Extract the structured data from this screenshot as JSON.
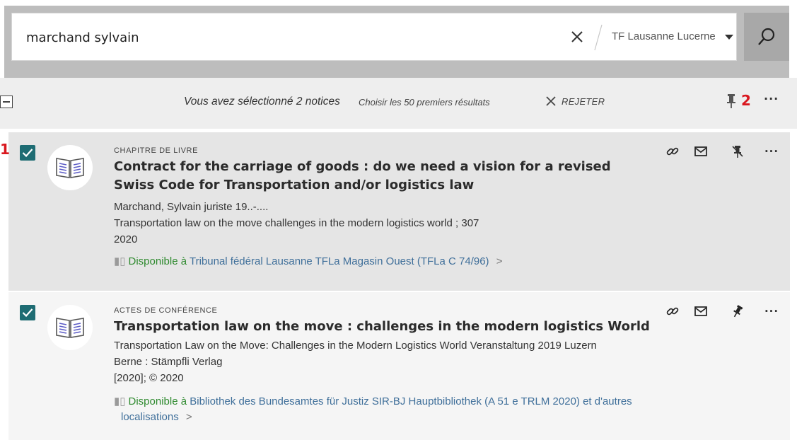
{
  "search": {
    "query": "marchand sylvain",
    "scope": "TF Lausanne Lucerne"
  },
  "toolbar": {
    "selected_text": "Vous avez sélectionné 2 notices",
    "choose_first": "Choisir les 50 premiers résultats",
    "reject_label": "REJETER",
    "pinned_count": "2",
    "more": "···"
  },
  "records": [
    {
      "number": "1",
      "type": "CHAPITRE DE LIVRE",
      "title": "Contract for the carriage of goods : do we need a vision for a revised Swiss Code for Transportation and/or logistics law",
      "author": "Marchand, Sylvain juriste 19..-....",
      "source": "Transportation law on the move challenges in the modern logistics world ; 307",
      "date": "2020",
      "availability_status": "Disponible à",
      "availability_location": "Tribunal fédéral Lausanne  TFLa Magasin Ouest (TFLa C 74/96)",
      "chevron": ">",
      "checked": true,
      "pinned": true
    },
    {
      "number": "",
      "type": "ACTES DE CONFÉRENCE",
      "title": "Transportation law on the move : challenges in the modern logistics World",
      "author": "Transportation Law on the Move: Challenges in the Modern Logistics World Veranstaltung 2019 Luzern",
      "publisher": "Berne : Stämpfli Verlag",
      "date": "[2020]; © 2020",
      "availability_status": "Disponible à",
      "availability_location": "Bibliothek des Bundesamtes für Justiz  SIR-BJ Hauptbibliothek (A 51 e TRLM 2020) et d'autres",
      "availability_location_2": "localisations",
      "chevron": ">",
      "checked": true,
      "pinned": false
    }
  ],
  "icons": {
    "clear": "close-icon",
    "search": "search-icon",
    "pin": "pin-icon",
    "unpin": "unpin-icon",
    "link": "link-icon",
    "email": "email-icon",
    "more": "more-icon",
    "book": "book-icon"
  },
  "colors": {
    "accent": "#1e6c73",
    "annotation": "#d9171e",
    "available": "#2f8a2f",
    "link": "#3f6f9a"
  }
}
